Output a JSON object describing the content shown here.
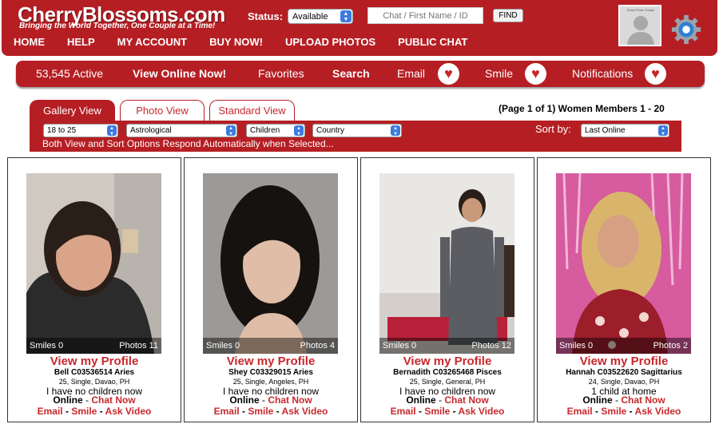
{
  "header": {
    "logo_text": "CherryBlossoms.com",
    "tagline": "Bringing the World Together, One Couple at a Time!",
    "status_label": "Status:",
    "status_value": "Available",
    "search_placeholder": "Chat / First Name / ID",
    "find_label": "FIND",
    "avatar_caption": "Show Photo Today!",
    "nav": [
      "HOME",
      "HELP",
      "MY ACCOUNT",
      "BUY NOW!",
      "UPLOAD PHOTOS",
      "PUBLIC CHAT"
    ]
  },
  "bar": {
    "active": "53,545 Active",
    "view_online": "View Online Now!",
    "favorites": "Favorites",
    "search": "Search",
    "email": "Email",
    "smile": "Smile",
    "notifications": "Notifications"
  },
  "tabs": [
    "Gallery View",
    "Photo View",
    "Standard View"
  ],
  "page_info": "(Page 1 of 1) Women Members 1 - 20",
  "filters": {
    "age": "18 to 25",
    "astro": "Astrological",
    "children": "Children",
    "country": "Country",
    "note": "Both View and Sort Options Respond Automatically when Selected...",
    "sort_label": "Sort by:",
    "sort_value": "Last Online"
  },
  "labels": {
    "view_profile": "View my Profile",
    "online": "Online",
    "chat_now": "Chat Now",
    "email": "Email",
    "smile": "Smile",
    "ask_video": "Ask Video"
  },
  "members": [
    {
      "smiles": "Smiles 0",
      "photos": "Photos 11",
      "name": "Bell C03536514 Aries",
      "info": "25, Single, Davao, PH",
      "children": "I have no children now"
    },
    {
      "smiles": "Smiles 0",
      "photos": "Photos 4",
      "name": "Shey C03329015 Aries",
      "info": "25, Single, Angeles, PH",
      "children": "I have no children now"
    },
    {
      "smiles": "Smiles 0",
      "photos": "Photos 12",
      "name": "Bernadith C03265468 Pisces",
      "info": "25, Single, General, PH",
      "children": "I have no children now"
    },
    {
      "smiles": "Smiles 0",
      "photos": "Photos 2",
      "name": "Hannah C03522620 Sagittarius",
      "info": "24, Single, Davao, PH",
      "children": "1 child at home"
    }
  ],
  "colors": {
    "brand_red": "#b51f24",
    "link_red": "#c8282d"
  }
}
